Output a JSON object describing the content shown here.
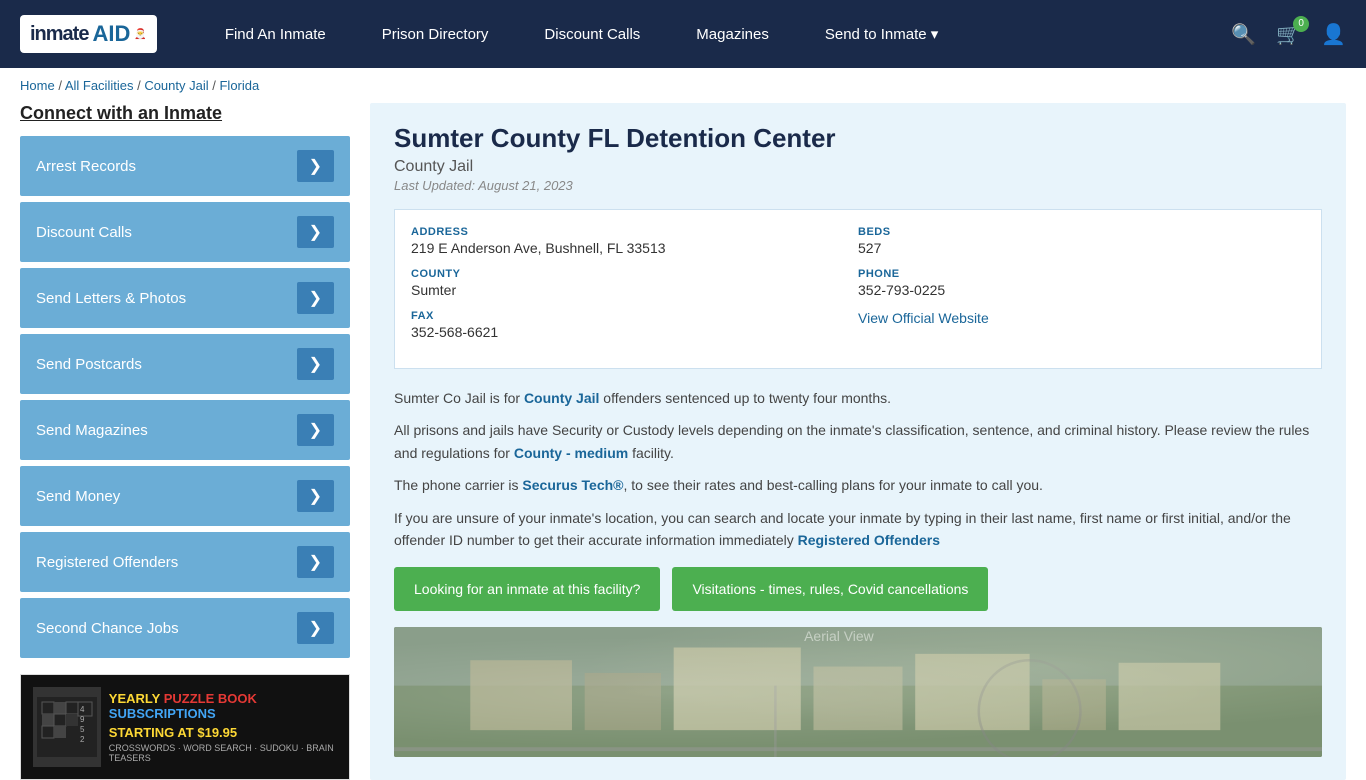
{
  "navbar": {
    "logo_text": "inmateAID",
    "nav_items": [
      {
        "label": "Find An Inmate",
        "id": "find-inmate"
      },
      {
        "label": "Prison Directory",
        "id": "prison-directory"
      },
      {
        "label": "Discount Calls",
        "id": "discount-calls"
      },
      {
        "label": "Magazines",
        "id": "magazines"
      },
      {
        "label": "Send to Inmate ▾",
        "id": "send-to-inmate"
      }
    ],
    "cart_count": "0"
  },
  "breadcrumb": {
    "items": [
      "Home",
      "All Facilities",
      "County Jail",
      "Florida"
    ]
  },
  "sidebar": {
    "title": "Connect with an Inmate",
    "items": [
      {
        "label": "Arrest Records"
      },
      {
        "label": "Discount Calls"
      },
      {
        "label": "Send Letters & Photos"
      },
      {
        "label": "Send Postcards"
      },
      {
        "label": "Send Magazines"
      },
      {
        "label": "Send Money"
      },
      {
        "label": "Registered Offenders"
      },
      {
        "label": "Second Chance Jobs"
      }
    ],
    "ad": {
      "title_part1": "YEARLY PUZZLE BOOK",
      "title_part2": "SUBSCRIPTIONS",
      "price": "STARTING AT $19.95",
      "desc": "CROSSWORDS · WORD SEARCH · SUDOKU · BRAIN TEASERS"
    }
  },
  "facility": {
    "title": "Sumter County FL Detention Center",
    "type": "County Jail",
    "updated": "Last Updated: August 21, 2023",
    "address_label": "ADDRESS",
    "address_value": "219 E Anderson Ave, Bushnell, FL 33513",
    "beds_label": "BEDS",
    "beds_value": "527",
    "county_label": "COUNTY",
    "county_value": "Sumter",
    "phone_label": "PHONE",
    "phone_value": "352-793-0225",
    "fax_label": "FAX",
    "fax_value": "352-568-6621",
    "website_label": "View Official Website",
    "desc1": "Sumter Co Jail is for County Jail offenders sentenced up to twenty four months.",
    "desc2": "All prisons and jails have Security or Custody levels depending on the inmate's classification, sentence, and criminal history. Please review the rules and regulations for County - medium facility.",
    "desc3": "The phone carrier is Securus Tech®, to see their rates and best-calling plans for your inmate to call you.",
    "desc4": "If you are unsure of your inmate's location, you can search and locate your inmate by typing in their last name, first name or first initial, and/or the offender ID number to get their accurate information immediately Registered Offenders",
    "btn1": "Looking for an inmate at this facility?",
    "btn2": "Visitations - times, rules, Covid cancellations"
  }
}
